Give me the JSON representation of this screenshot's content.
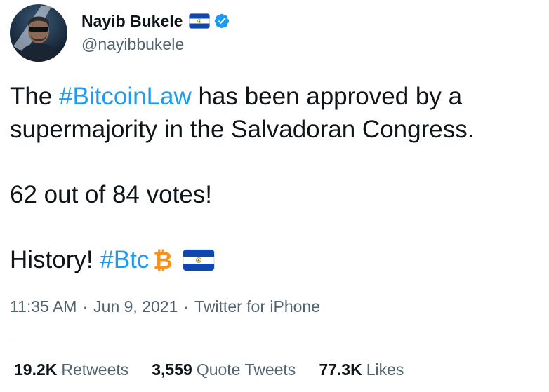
{
  "author": {
    "display_name": "Nayib Bukele",
    "handle": "@nayibbukele",
    "flag_icon": "el-salvador-flag-icon",
    "verified_icon": "verified-badge-icon"
  },
  "tweet": {
    "line1_pre": "The ",
    "line1_hashtag": "#BitcoinLaw",
    "line1_post": " has been approved by a",
    "line2": "supermajority in the Salvadoran Congress.",
    "line3": "62 out of 84 votes!",
    "line4_pre": "History! ",
    "line4_hashtag": "#Btc",
    "emojis": [
      "bitcoin-icon",
      "el-salvador-flag-icon"
    ]
  },
  "meta": {
    "time": "11:35 AM",
    "separator": "·",
    "date": "Jun 9, 2021",
    "source": "Twitter for iPhone"
  },
  "stats": {
    "retweets_count": "19.2K",
    "retweets_label": "Retweets",
    "quotes_count": "3,559",
    "quotes_label": "Quote Tweets",
    "likes_count": "77.3K",
    "likes_label": "Likes"
  },
  "colors": {
    "text": "#0f1419",
    "secondary": "#536471",
    "link": "#1d9bf0",
    "bitcoin": "#f7931a",
    "flag_blue": "#0f47af"
  }
}
